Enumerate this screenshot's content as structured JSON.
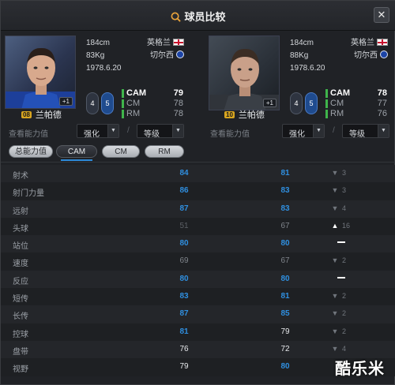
{
  "window": {
    "title": "球员比较",
    "close_label": "✕"
  },
  "players": [
    {
      "height": "184cm",
      "weight": "83Kg",
      "birth": "1978.6.20",
      "nation": "英格兰",
      "club": "切尔西",
      "number": "08",
      "name": "兰帕德",
      "plus": "+1",
      "foot_left": "4",
      "foot_right": "5",
      "positions": [
        {
          "pos": "CAM",
          "val": "79",
          "main": true
        },
        {
          "pos": "CM",
          "val": "78",
          "main": false
        },
        {
          "pos": "RM",
          "val": "78",
          "main": false
        }
      ],
      "view_label": "查看能力值",
      "select_a": "强化",
      "select_b": "等级",
      "slash": "/"
    },
    {
      "height": "184cm",
      "weight": "88Kg",
      "birth": "1978.6.20",
      "nation": "英格兰",
      "club": "切尔西",
      "number": "10",
      "name": "兰帕德",
      "plus": "+1",
      "foot_left": "4",
      "foot_right": "5",
      "positions": [
        {
          "pos": "CAM",
          "val": "78",
          "main": true
        },
        {
          "pos": "CM",
          "val": "77",
          "main": false
        },
        {
          "pos": "RM",
          "val": "76",
          "main": false
        }
      ],
      "view_label": "查看能力值",
      "select_a": "强化",
      "select_b": "等级",
      "slash": "/"
    }
  ],
  "tabs": [
    "总能力值",
    "CAM",
    "CM",
    "RM"
  ],
  "active_tab": "CAM",
  "stats": [
    {
      "label": "射术",
      "v1": "84",
      "c1": "blue",
      "v2": "81",
      "c2": "blue",
      "diff": "3",
      "dir": "down"
    },
    {
      "label": "射门力量",
      "v1": "86",
      "c1": "blue",
      "v2": "83",
      "c2": "blue",
      "diff": "3",
      "dir": "down"
    },
    {
      "label": "远射",
      "v1": "87",
      "c1": "blue",
      "v2": "83",
      "c2": "blue",
      "diff": "4",
      "dir": "down"
    },
    {
      "label": "头球",
      "v1": "51",
      "c1": "dim",
      "v2": "67",
      "c2": "grey",
      "diff": "16",
      "dir": "up"
    },
    {
      "label": "站位",
      "v1": "80",
      "c1": "blue",
      "v2": "80",
      "c2": "blue",
      "diff": "",
      "dir": "equal"
    },
    {
      "label": "速度",
      "v1": "69",
      "c1": "grey",
      "v2": "67",
      "c2": "grey",
      "diff": "2",
      "dir": "down"
    },
    {
      "label": "反应",
      "v1": "80",
      "c1": "blue",
      "v2": "80",
      "c2": "blue",
      "diff": "",
      "dir": "equal"
    },
    {
      "label": "短传",
      "v1": "83",
      "c1": "blue",
      "v2": "81",
      "c2": "blue",
      "diff": "2",
      "dir": "down"
    },
    {
      "label": "长传",
      "v1": "87",
      "c1": "blue",
      "v2": "85",
      "c2": "blue",
      "diff": "2",
      "dir": "down"
    },
    {
      "label": "控球",
      "v1": "81",
      "c1": "blue",
      "v2": "79",
      "c2": "white",
      "diff": "2",
      "dir": "down"
    },
    {
      "label": "盘带",
      "v1": "76",
      "c1": "white",
      "v2": "72",
      "c2": "white",
      "diff": "4",
      "dir": "down"
    },
    {
      "label": "视野",
      "v1": "79",
      "c1": "white",
      "v2": "80",
      "c2": "blue",
      "diff": "",
      "dir": "none"
    }
  ],
  "watermark": "酷乐米",
  "colors": {
    "accent_blue": "#2f8fe0",
    "position_bar": "#3fb54b",
    "badge_gold": "#d8a520"
  }
}
